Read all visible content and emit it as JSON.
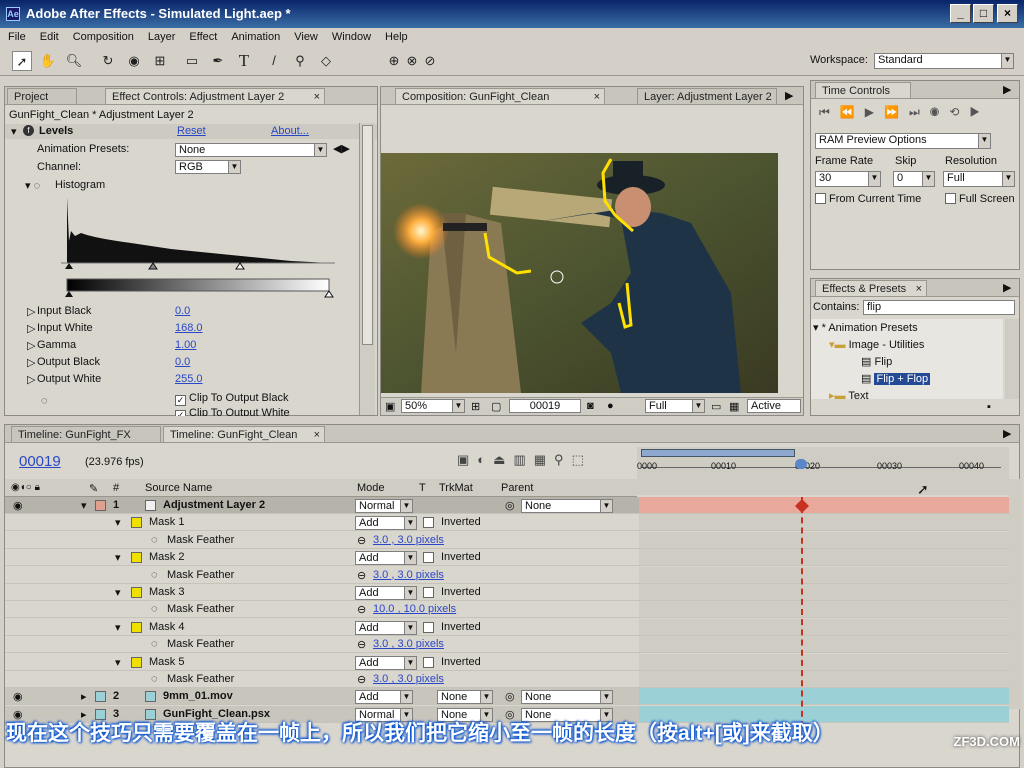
{
  "window": {
    "title": "Adobe After Effects - Simulated Light.aep *"
  },
  "menu": [
    "File",
    "Edit",
    "Composition",
    "Layer",
    "Effect",
    "Animation",
    "View",
    "Window",
    "Help"
  ],
  "toolbar": {
    "workspace_label": "Workspace:",
    "workspace_value": "Standard"
  },
  "left_panel": {
    "tab_project": "Project",
    "tab_effect_controls": "Effect Controls: Adjustment Layer 2",
    "breadcrumb": "GunFight_Clean * Adjustment Layer 2",
    "effect_name": "Levels",
    "reset": "Reset",
    "about": "About...",
    "animation_presets_label": "Animation Presets:",
    "animation_presets_value": "None",
    "channel_label": "Channel:",
    "channel_value": "RGB",
    "histogram_label": "Histogram",
    "params": [
      {
        "label": "Input Black",
        "value": "0.0"
      },
      {
        "label": "Input White",
        "value": "168.0"
      },
      {
        "label": "Gamma",
        "value": "1.00"
      },
      {
        "label": "Output Black",
        "value": "0.0"
      },
      {
        "label": "Output White",
        "value": "255.0"
      }
    ],
    "clip_black": "Clip To Output Black",
    "clip_white": "Clip To Output White"
  },
  "comp_panel": {
    "tab_comp": "Composition: GunFight_Clean",
    "tab_layer": "Layer: Adjustment Layer 2",
    "zoom": "50%",
    "timecode": "00019",
    "resolution": "Full",
    "active_camera": "Active Cam"
  },
  "time_controls": {
    "title": "Time Controls",
    "ram_preview": "RAM Preview Options",
    "frame_rate_label": "Frame Rate",
    "frame_rate_value": "30",
    "skip_label": "Skip",
    "skip_value": "0",
    "resolution_label": "Resolution",
    "resolution_value": "Full",
    "from_current_time": "From Current Time",
    "full_screen": "Full Screen"
  },
  "effects_presets": {
    "title": "Effects & Presets",
    "contains_label": "Contains:",
    "contains_value": "flip",
    "tree": [
      {
        "label": "* Animation Presets",
        "indent": 0
      },
      {
        "label": "Image - Utilities",
        "indent": 1
      },
      {
        "label": "Flip",
        "indent": 2
      },
      {
        "label": "Flip + Flop",
        "indent": 2
      },
      {
        "label": "Text",
        "indent": 1
      }
    ]
  },
  "timeline": {
    "tab_fx": "Timeline: GunFight_FX",
    "tab_clean": "Timeline: GunFight_Clean",
    "current_time": "00019",
    "fps": "(23.976 fps)",
    "headers": {
      "num": "#",
      "source": "Source Name",
      "mode": "Mode",
      "t": "T",
      "trkmat": "TrkMat",
      "parent": "Parent"
    },
    "ruler": [
      "0000",
      "00010",
      "00020",
      "00030",
      "00040"
    ],
    "layers": [
      {
        "type": "layer",
        "num": "1",
        "name": "Adjustment Layer 2",
        "mode": "Normal",
        "parent": "None",
        "color": "#f0f0f0",
        "selected": true
      },
      {
        "type": "mask",
        "name": "Mask 1",
        "mode": "Add",
        "inverted": "Inverted"
      },
      {
        "type": "feather",
        "name": "Mask Feather",
        "value": "3.0 , 3.0 pixels"
      },
      {
        "type": "mask",
        "name": "Mask 2",
        "mode": "Add",
        "inverted": "Inverted"
      },
      {
        "type": "feather",
        "name": "Mask Feather",
        "value": "3.0 , 3.0 pixels"
      },
      {
        "type": "mask",
        "name": "Mask 3",
        "mode": "Add",
        "inverted": "Inverted"
      },
      {
        "type": "feather",
        "name": "Mask Feather",
        "value": "10.0 , 10.0 pixels"
      },
      {
        "type": "mask",
        "name": "Mask 4",
        "mode": "Add",
        "inverted": "Inverted"
      },
      {
        "type": "feather",
        "name": "Mask Feather",
        "value": "3.0 , 3.0 pixels"
      },
      {
        "type": "mask",
        "name": "Mask 5",
        "mode": "Add",
        "inverted": "Inverted"
      },
      {
        "type": "feather",
        "name": "Mask Feather",
        "value": "3.0 , 3.0 pixels"
      },
      {
        "type": "layer",
        "num": "2",
        "name": "9mm_01.mov",
        "mode": "Add",
        "trkmat": "None",
        "parent": "None",
        "color": "#9ad0d6",
        "selected": false
      },
      {
        "type": "layer",
        "num": "3",
        "name": "GunFight_Clean.psx",
        "mode": "Normal",
        "trkmat": "None",
        "parent": "None",
        "color": "#9ad0d6",
        "selected": false
      }
    ]
  },
  "subtitle": "现在这个技巧只需要覆盖在一帧上，所以我们把它缩小至一帧的长度（按alt+[或]来截取）",
  "watermark": "ZF3D.COM"
}
